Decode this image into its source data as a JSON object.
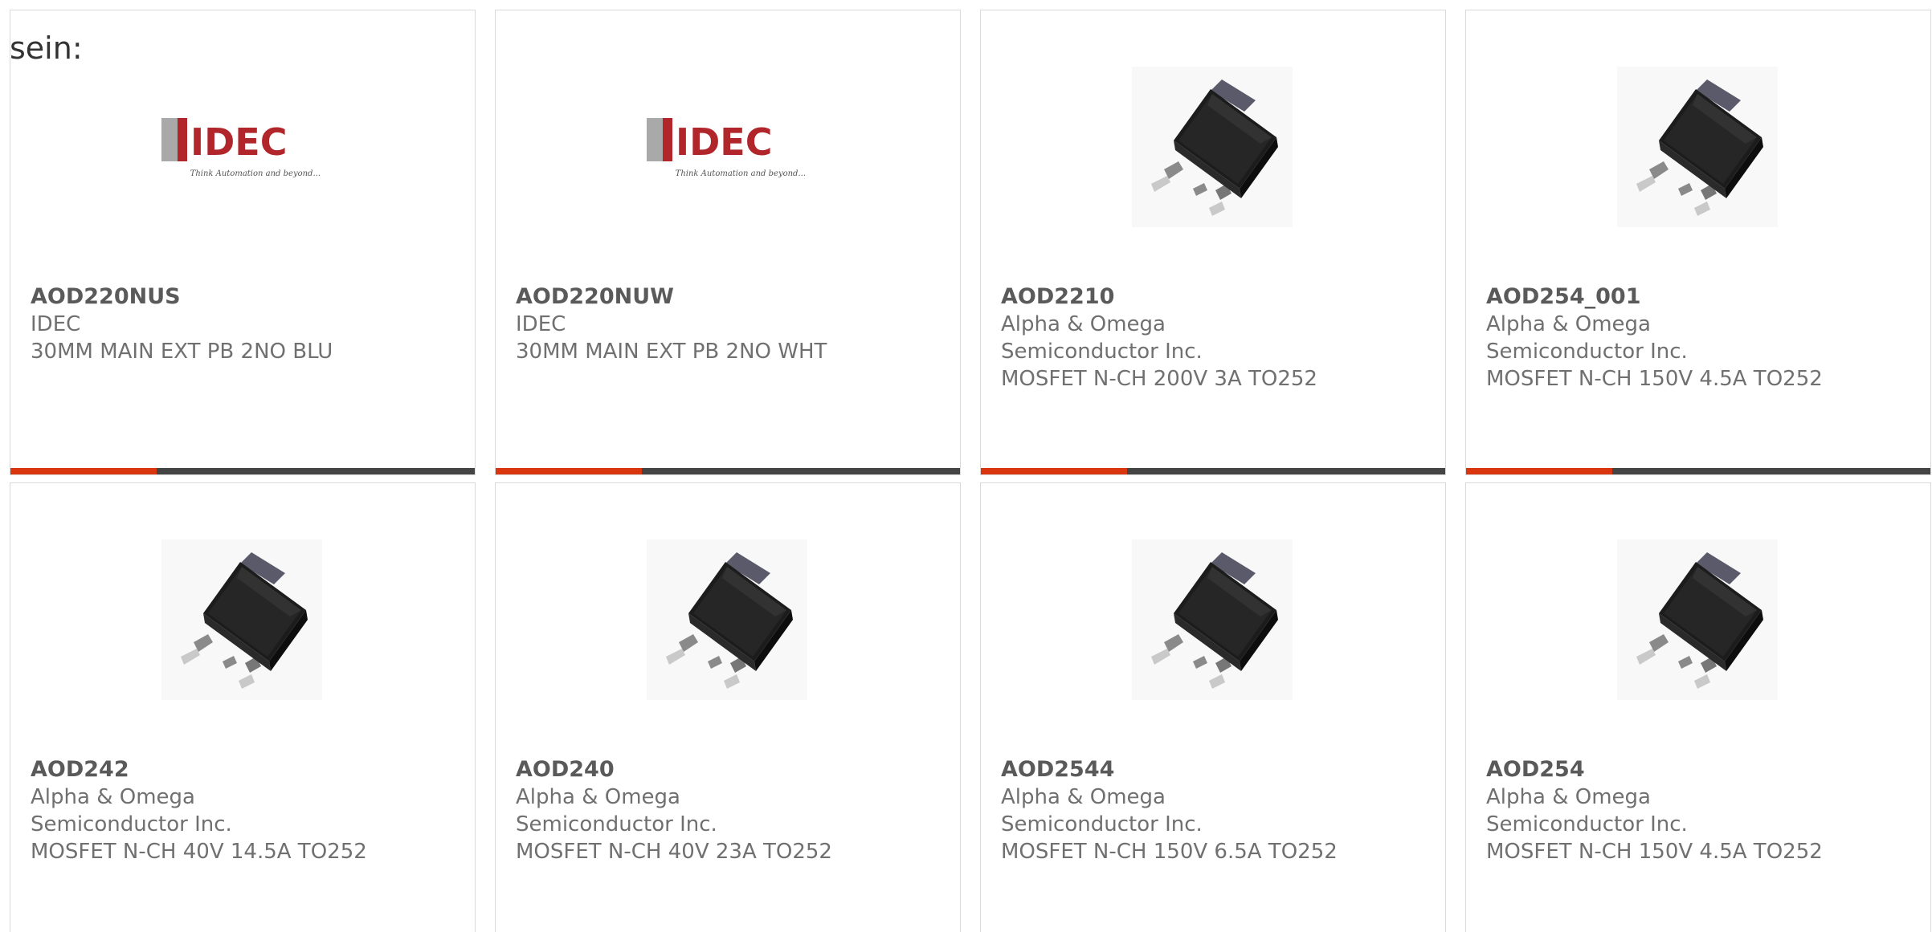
{
  "intro_text": "sein:",
  "colors": {
    "accent": "#d9360f",
    "bar_dark": "#444444",
    "idec_red": "#b0262b",
    "text_gray": "#707070"
  },
  "products": [
    {
      "part_number": "AOD220NUS",
      "manufacturer": "IDEC",
      "description": "30MM MAIN EXT PB 2NO BLU",
      "image": "idec-logo",
      "logo_text": "IDEC",
      "logo_tagline": "Think Automation and beyond..."
    },
    {
      "part_number": "AOD220NUW",
      "manufacturer": "IDEC",
      "description": "30MM MAIN EXT PB 2NO WHT",
      "image": "idec-logo",
      "logo_text": "IDEC",
      "logo_tagline": "Think Automation and beyond..."
    },
    {
      "part_number": "AOD2210",
      "manufacturer": "Alpha & Omega Semiconductor Inc.",
      "description": "MOSFET N-CH 200V 3A TO252",
      "image": "to252-package-icon"
    },
    {
      "part_number": "AOD254_001",
      "manufacturer": "Alpha & Omega Semiconductor Inc.",
      "description": "MOSFET N-CH 150V 4.5A TO252",
      "image": "to252-package-icon"
    },
    {
      "part_number": "AOD242",
      "manufacturer": "Alpha & Omega Semiconductor Inc.",
      "description": "MOSFET N-CH 40V 14.5A TO252",
      "image": "to252-package-icon"
    },
    {
      "part_number": "AOD240",
      "manufacturer": "Alpha & Omega Semiconductor Inc.",
      "description": "MOSFET N-CH 40V 23A TO252",
      "image": "to252-package-icon"
    },
    {
      "part_number": "AOD2544",
      "manufacturer": "Alpha & Omega Semiconductor Inc.",
      "description": "MOSFET N-CH 150V 6.5A TO252",
      "image": "to252-package-icon"
    },
    {
      "part_number": "AOD254",
      "manufacturer": "Alpha & Omega Semiconductor Inc.",
      "description": "MOSFET N-CH 150V 4.5A TO252",
      "image": "to252-package-icon"
    }
  ]
}
